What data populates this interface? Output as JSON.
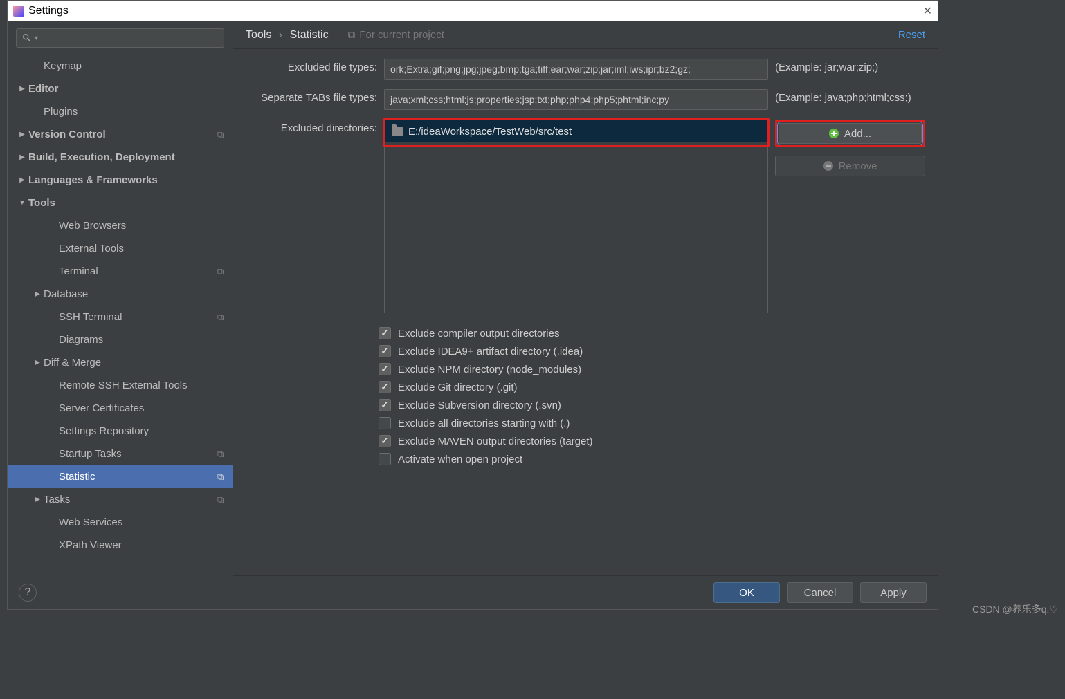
{
  "window": {
    "title": "Settings"
  },
  "sidebar": {
    "items": [
      {
        "label": "Keymap",
        "type": "leaf",
        "indent": 1
      },
      {
        "label": "Editor",
        "type": "collapsed",
        "indent": 0,
        "pin": false
      },
      {
        "label": "Plugins",
        "type": "leaf",
        "indent": 1
      },
      {
        "label": "Version Control",
        "type": "collapsed",
        "indent": 0,
        "pin": true
      },
      {
        "label": "Build, Execution, Deployment",
        "type": "collapsed",
        "indent": 0
      },
      {
        "label": "Languages & Frameworks",
        "type": "collapsed",
        "indent": 0
      },
      {
        "label": "Tools",
        "type": "expanded",
        "indent": 0
      },
      {
        "label": "Web Browsers",
        "type": "leaf",
        "indent": 2
      },
      {
        "label": "External Tools",
        "type": "leaf",
        "indent": 2
      },
      {
        "label": "Terminal",
        "type": "leaf",
        "indent": 2,
        "pin": true
      },
      {
        "label": "Database",
        "type": "collapsed",
        "indent": 1
      },
      {
        "label": "SSH Terminal",
        "type": "leaf",
        "indent": 2,
        "pin": true
      },
      {
        "label": "Diagrams",
        "type": "leaf",
        "indent": 2
      },
      {
        "label": "Diff & Merge",
        "type": "collapsed",
        "indent": 1
      },
      {
        "label": "Remote SSH External Tools",
        "type": "leaf",
        "indent": 2
      },
      {
        "label": "Server Certificates",
        "type": "leaf",
        "indent": 2
      },
      {
        "label": "Settings Repository",
        "type": "leaf",
        "indent": 2
      },
      {
        "label": "Startup Tasks",
        "type": "leaf",
        "indent": 2,
        "pin": true
      },
      {
        "label": "Statistic",
        "type": "leaf",
        "indent": 2,
        "pin": true,
        "selected": true
      },
      {
        "label": "Tasks",
        "type": "collapsed",
        "indent": 1,
        "pin": true
      },
      {
        "label": "Web Services",
        "type": "leaf",
        "indent": 2
      },
      {
        "label": "XPath Viewer",
        "type": "leaf",
        "indent": 2
      }
    ]
  },
  "breadcrumb": {
    "root": "Tools",
    "leaf": "Statistic"
  },
  "project_hint": "For current project",
  "reset_label": "Reset",
  "form": {
    "excluded_types_label": "Excluded file types:",
    "excluded_types_value": "ork;Extra;gif;png;jpg;jpeg;bmp;tga;tiff;ear;war;zip;jar;iml;iws;ipr;bz2;gz;",
    "excluded_types_example": "(Example: jar;war;zip;)",
    "separate_tabs_label": "Separate TABs file types:",
    "separate_tabs_value": "java;xml;css;html;js;properties;jsp;txt;php;php4;php5;phtml;inc;py",
    "separate_tabs_example": "(Example: java;php;html;css;)",
    "excluded_dirs_label": "Excluded directories:",
    "excluded_dir_item": "E:/ideaWorkspace/TestWeb/src/test",
    "add_label": "Add...",
    "remove_label": "Remove"
  },
  "checks": [
    {
      "label": "Exclude compiler output directories",
      "checked": true
    },
    {
      "label": "Exclude IDEA9+ artifact directory (.idea)",
      "checked": true
    },
    {
      "label": "Exclude NPM directory (node_modules)",
      "checked": true
    },
    {
      "label": "Exclude Git directory (.git)",
      "checked": true
    },
    {
      "label": "Exclude Subversion directory (.svn)",
      "checked": true
    },
    {
      "label": "Exclude all directories starting with (.)",
      "checked": false
    },
    {
      "label": "Exclude MAVEN output directories (target)",
      "checked": true
    },
    {
      "label": "Activate when open project",
      "checked": false
    }
  ],
  "footer": {
    "ok": "OK",
    "cancel": "Cancel",
    "apply": "Apply",
    "help": "?"
  },
  "watermark": "CSDN @养乐多q.♡"
}
